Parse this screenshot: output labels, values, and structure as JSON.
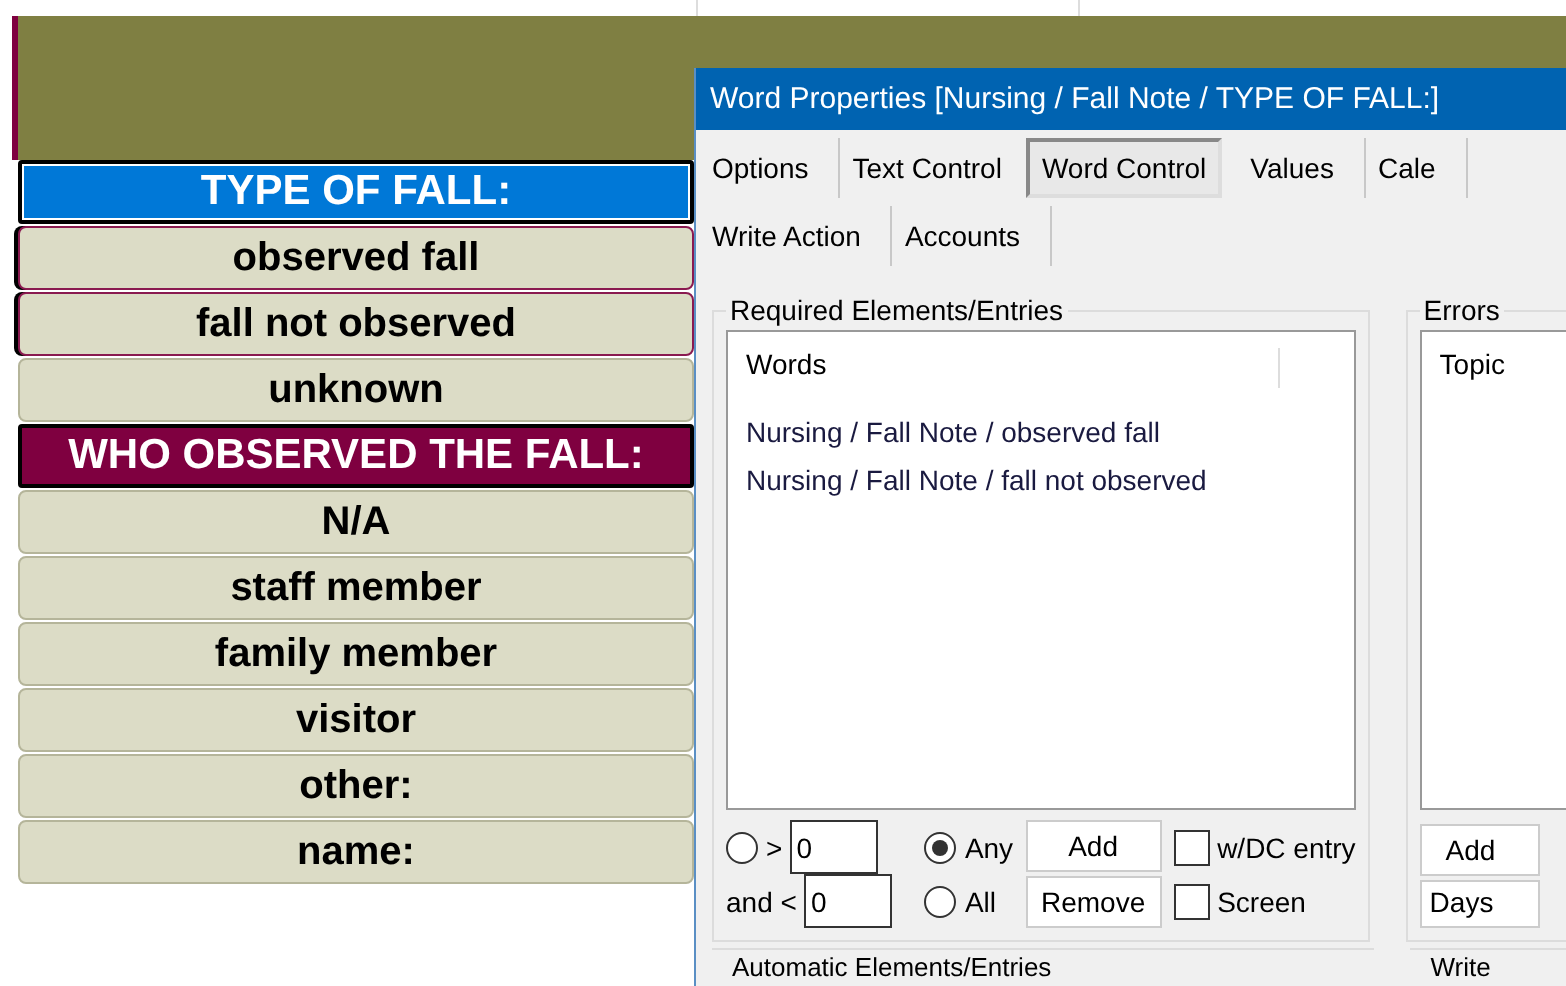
{
  "note_list": [
    {
      "kind": "header",
      "label": "TYPE OF FALL:",
      "color": "#0078d7",
      "selected": true
    },
    {
      "kind": "option",
      "label": "observed fall",
      "selected": true
    },
    {
      "kind": "option",
      "label": "fall not observed",
      "selected": true
    },
    {
      "kind": "option",
      "label": "unknown",
      "selected": false
    },
    {
      "kind": "header",
      "label": "WHO OBSERVED THE FALL:",
      "color": "#7f0040",
      "selected": false
    },
    {
      "kind": "option",
      "label": "N/A",
      "selected": false
    },
    {
      "kind": "option",
      "label": "staff member",
      "selected": false
    },
    {
      "kind": "option",
      "label": "family member",
      "selected": false
    },
    {
      "kind": "option",
      "label": "visitor",
      "selected": false
    },
    {
      "kind": "option",
      "label": "other:",
      "selected": false
    },
    {
      "kind": "option",
      "label": "name:",
      "selected": false
    }
  ],
  "dialog": {
    "title": "Word Properties [Nursing / Fall Note / TYPE OF FALL:]",
    "tab_rows": [
      [
        {
          "label": "Options",
          "selected": false
        },
        {
          "label": "Text Control",
          "selected": false
        },
        {
          "label": "Word Control",
          "selected": true
        },
        {
          "label": "Values",
          "selected": false
        },
        {
          "label": "Cale",
          "selected": false
        }
      ],
      [
        {
          "label": "Write Action",
          "selected": false
        },
        {
          "label": "Accounts",
          "selected": false
        }
      ]
    ],
    "required": {
      "label": "Required Elements/Entries",
      "column": "Words",
      "items": [
        "Nursing / Fall Note / observed fall",
        "Nursing / Fall Note / fall not observed"
      ],
      "count_range": {
        "radio_label": ">",
        "selected": false,
        "min_value": "0",
        "and_label": "and <",
        "max_value": "0"
      },
      "match": [
        {
          "label": "Any",
          "selected": true
        },
        {
          "label": "All",
          "selected": false
        }
      ],
      "buttons": [
        "Add",
        "Remove"
      ],
      "checkboxes": [
        {
          "label": "w/DC entry",
          "checked": false
        },
        {
          "label": "Screen",
          "checked": false
        }
      ]
    },
    "errors": {
      "label": "Errors",
      "column": "Topic",
      "button": "Add",
      "dropdown": "Days"
    },
    "lower_groups": [
      "Automatic Elements/Entries",
      "Write"
    ]
  }
}
